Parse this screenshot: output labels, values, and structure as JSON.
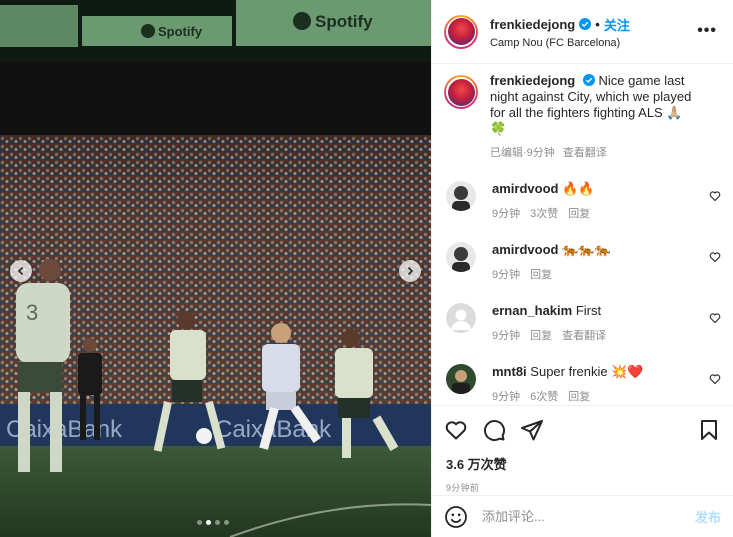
{
  "header": {
    "username": "frenkiedejong",
    "separator": "•",
    "follow_label": "关注",
    "location": "Camp Nou (FC Barcelona)",
    "more_icon": "more-horizontal-icon"
  },
  "photo": {
    "banner_text": "Spotify",
    "ad_text": "CaixaBank",
    "jersey_number": "3",
    "slide_count": 4,
    "active_slide": 1
  },
  "caption": {
    "username": "frenkiedejong",
    "text": "Nice game last night against City, which we played for all the fighters fighting ALS 🙏🏼",
    "text_line2": "🍀",
    "edited": "已编辑",
    "sep": "·",
    "time": "9分钟",
    "translate": "查看翻译"
  },
  "comments": [
    {
      "username": "amirdvood",
      "text": "🔥🔥",
      "time": "9分钟",
      "likes": "3次赞",
      "reply": "回复",
      "translate": ""
    },
    {
      "username": "amirdvood",
      "text": "🐅🐅🐅",
      "time": "9分钟",
      "likes": "",
      "reply": "回复",
      "translate": ""
    },
    {
      "username": "ernan_hakim",
      "text": "First",
      "time": "9分钟",
      "likes": "",
      "reply": "回复",
      "translate": "查看翻译"
    },
    {
      "username": "mnt8i",
      "text": "Super frenkie 💥❤️",
      "time": "9分钟",
      "likes": "6次赞",
      "reply": "回复",
      "translate": ""
    }
  ],
  "actions": {
    "likes_count": "3.6 万次赞",
    "posted_ago": "9分钟前",
    "comment_placeholder": "添加评论...",
    "post_label": "发布"
  },
  "colors": {
    "accent": "#0095f6",
    "post_disabled": "#b2dffc",
    "muted": "#8e8e8e",
    "border": "#efefef"
  }
}
